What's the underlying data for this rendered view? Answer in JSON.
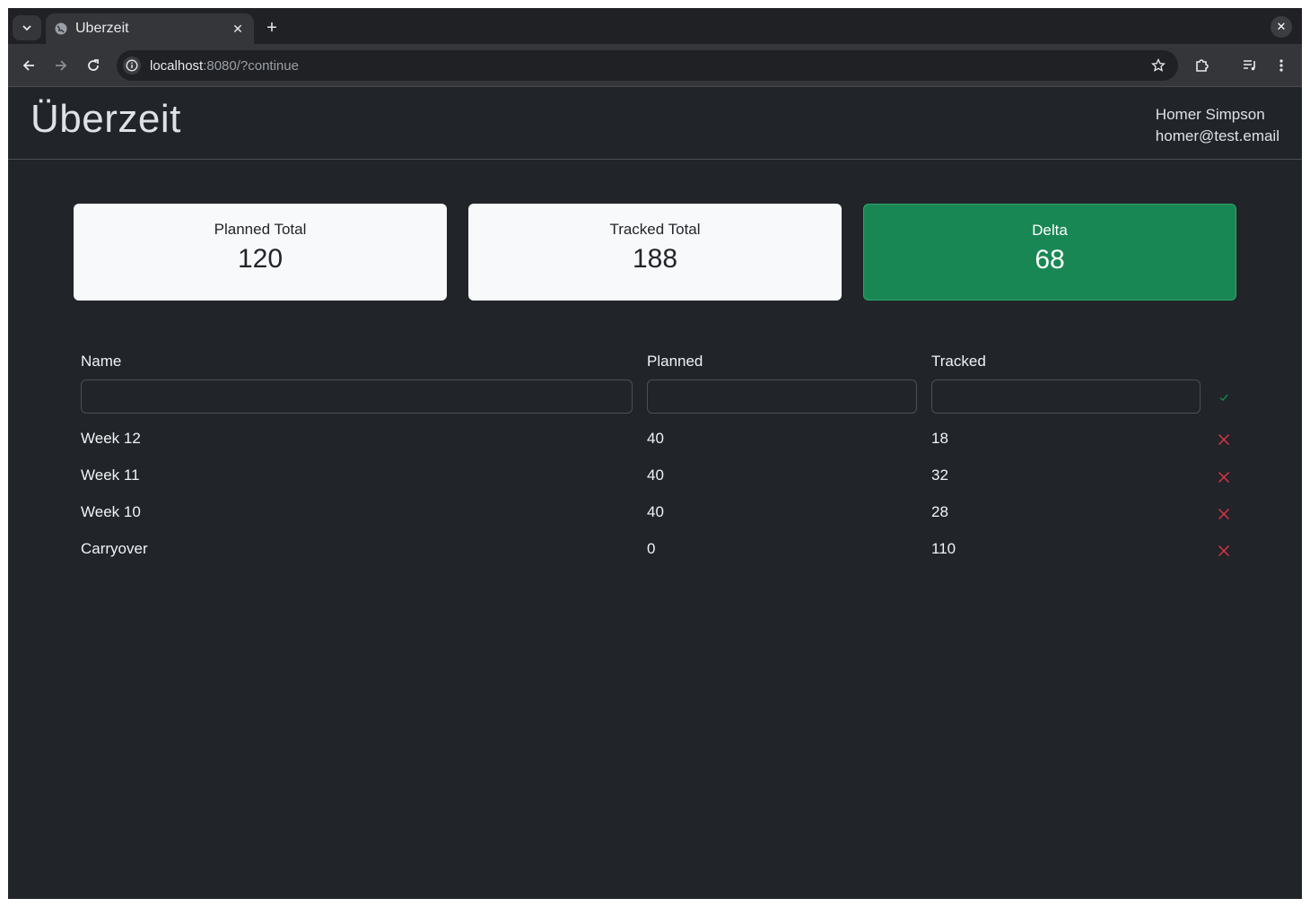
{
  "browser": {
    "tab_title": "Uberzeit",
    "url_host": "localhost",
    "url_rest": ":8080/?continue"
  },
  "app": {
    "brand": "Überzeit",
    "user_name": "Homer Simpson",
    "user_email": "homer@test.email"
  },
  "summary": {
    "planned_label": "Planned Total",
    "planned_value": "120",
    "tracked_label": "Tracked Total",
    "tracked_value": "188",
    "delta_label": "Delta",
    "delta_value": "68"
  },
  "table": {
    "headers": {
      "name": "Name",
      "planned": "Planned",
      "tracked": "Tracked"
    },
    "new_entry": {
      "name": "",
      "planned": "",
      "tracked": ""
    },
    "rows": [
      {
        "name": "Week 12",
        "planned": "40",
        "tracked": "18"
      },
      {
        "name": "Week 11",
        "planned": "40",
        "tracked": "32"
      },
      {
        "name": "Week 10",
        "planned": "40",
        "tracked": "28"
      },
      {
        "name": "Carryover",
        "planned": "0",
        "tracked": "110"
      }
    ]
  },
  "colors": {
    "background": "#212429",
    "delta_positive": "#198754",
    "delete_icon": "#dc3545",
    "confirm_icon": "#198754"
  },
  "icons": {
    "tab_search": "chevron-down-icon",
    "favicon": "globe-icon",
    "back": "arrow-left-icon",
    "forward": "arrow-right-icon",
    "reload": "reload-icon",
    "site_info": "info-icon",
    "bookmark": "star-icon",
    "extensions": "puzzle-icon",
    "media": "media-queue-icon",
    "menu": "kebab-menu-icon",
    "confirm": "check-icon",
    "delete": "x-icon"
  }
}
